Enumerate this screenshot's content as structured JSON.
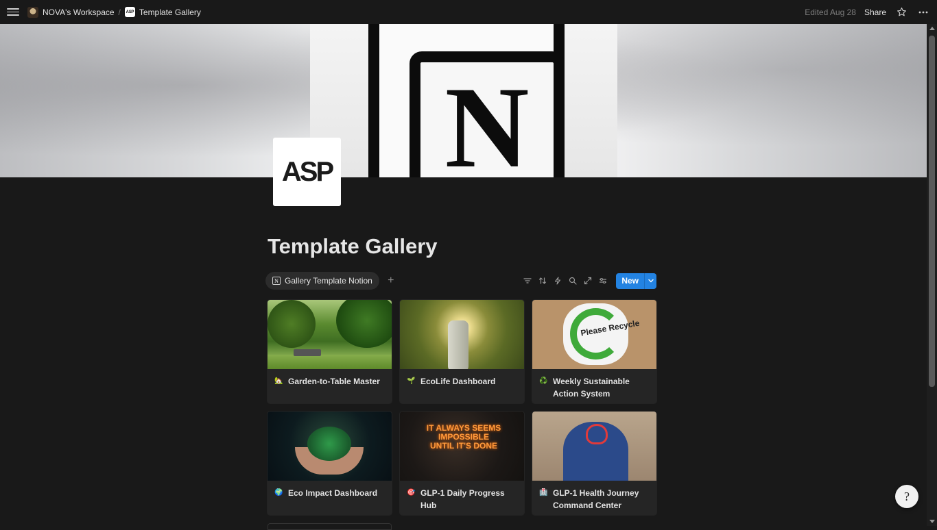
{
  "topbar": {
    "workspace_label": "NOVA's Workspace",
    "separator": "/",
    "page_label": "Template Gallery",
    "page_icon_text": "ASP",
    "edited": "Edited Aug 28",
    "share": "Share"
  },
  "page": {
    "icon_text": "ASP",
    "title": "Template Gallery",
    "cover_letter": "N"
  },
  "views": {
    "active_tab": "Gallery Template Notion",
    "active_tab_icon_text": "N",
    "add_view": "+",
    "new_button": "New"
  },
  "cards": [
    {
      "emoji": "🏡",
      "title": "Garden-to-Table Master"
    },
    {
      "emoji": "🌱",
      "title": "EcoLife Dashboard"
    },
    {
      "emoji": "♻️",
      "title": "Weekly Sustainable Action System"
    },
    {
      "emoji": "🌍",
      "title": "Eco Impact Dashboard"
    },
    {
      "emoji": "🎯",
      "title": "GLP-1 Daily Progress Hub"
    },
    {
      "emoji": "🏥",
      "title": "GLP-1 Health Journey Command Center"
    }
  ],
  "images": {
    "recycle_text": "Please Recycle",
    "neon_text": "IT ALWAYS SEEMS IMPOSSIBLE UNTIL IT'S DONE"
  },
  "help_glyph": "?"
}
